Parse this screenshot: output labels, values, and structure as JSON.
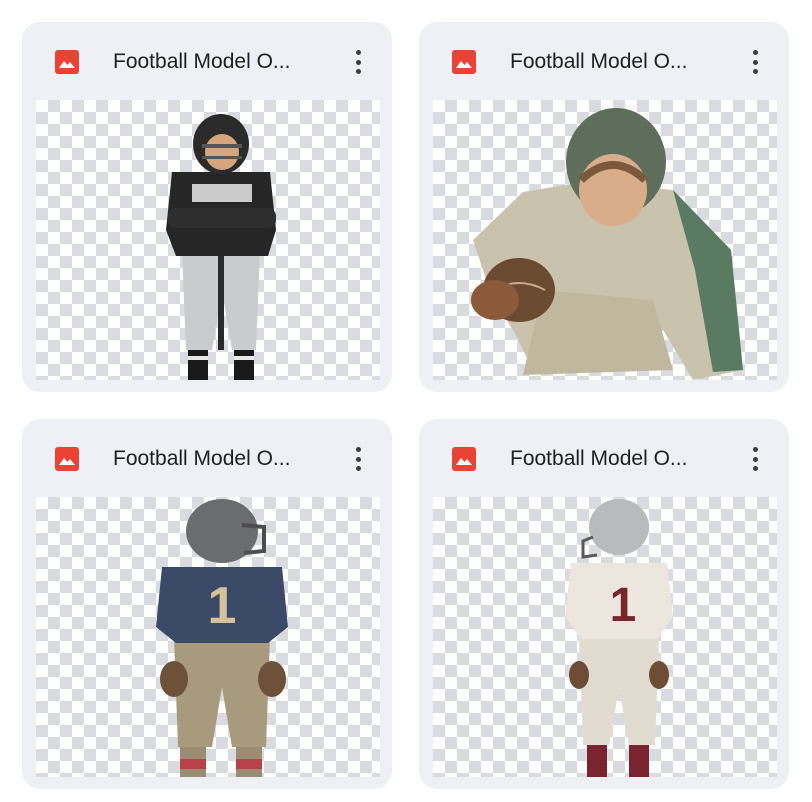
{
  "files": [
    {
      "title": "Football Model O...",
      "icon": "image-file-icon",
      "menu_icon": "more-vert-icon",
      "subject": "kid-standing-arms-crossed"
    },
    {
      "title": "Football Model O...",
      "icon": "image-file-icon",
      "menu_icon": "more-vert-icon",
      "subject": "kid-crouching-with-ball"
    },
    {
      "title": "Football Model O...",
      "icon": "image-file-icon",
      "menu_icon": "more-vert-icon",
      "subject": "kid-back-view-blue-jersey"
    },
    {
      "title": "Football Model O...",
      "icon": "image-file-icon",
      "menu_icon": "more-vert-icon",
      "subject": "kid-back-view-white-jersey"
    }
  ],
  "colors": {
    "card_bg": "#eef0f6",
    "icon_red": "#ea4335",
    "title_text": "#1f1f1f",
    "checker_dark": "#d9dbe0",
    "checker_light": "#ffffff"
  }
}
